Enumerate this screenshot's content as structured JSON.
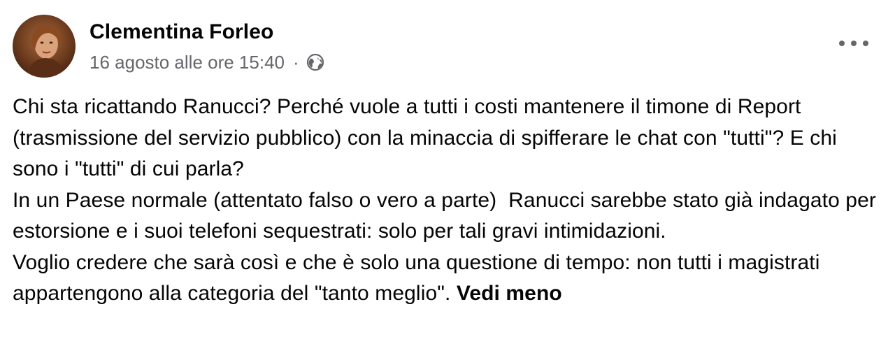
{
  "post": {
    "author": "Clementina Forleo",
    "timestamp": "16 agosto alle ore 15:40",
    "separator": "·",
    "audience_icon": "globe-icon",
    "more_icon": "more-options-icon",
    "paragraphs": [
      "Chi sta ricattando Ranucci? Perché vuole a tutti i costi mantenere il timone di Report (trasmissione del servizio pubblico) con la minaccia di spifferare le chat con \"tutti\"? E chi sono i \"tutti\" di cui parla?",
      "In un Paese normale (attentato falso o vero a parte)  Ranucci sarebbe stato già indagato per estorsione e i suoi telefoni sequestrati: solo per tali gravi intimidazioni.",
      "Voglio credere che sarà così e che è solo una questione di tempo: non tutti i magistrati appartengono alla categoria del \"tanto meglio\". "
    ],
    "see_less_label": "Vedi meno"
  },
  "colors": {
    "text": "#050505",
    "secondary": "#65676b",
    "background": "#ffffff"
  }
}
